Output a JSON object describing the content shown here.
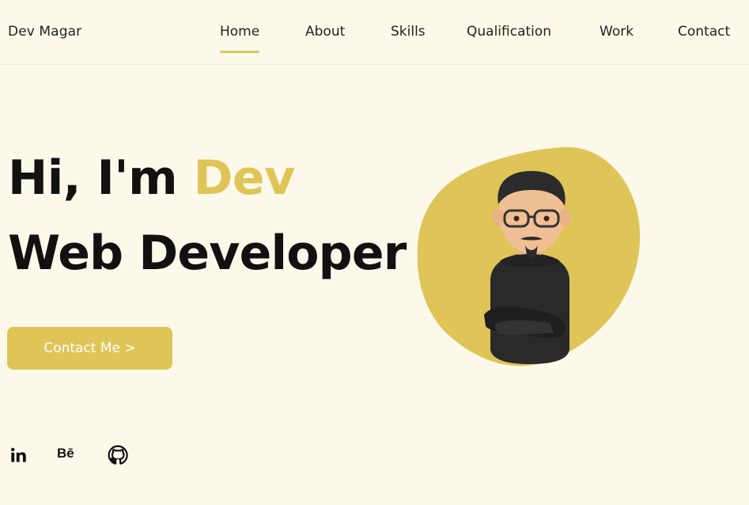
{
  "brand": {
    "name": "Dev Magar"
  },
  "nav": {
    "items": [
      {
        "label": "Home",
        "active": true
      },
      {
        "label": "About",
        "active": false
      },
      {
        "label": "Skills",
        "active": false
      },
      {
        "label": "Qualification",
        "active": false
      },
      {
        "label": "Work",
        "active": false
      },
      {
        "label": "Contact",
        "active": false
      }
    ]
  },
  "hero": {
    "greeting": "Hi, I'm ",
    "name": "Dev",
    "title": "Web Developer",
    "cta_label": "Contact Me >"
  },
  "socials": {
    "behance_label": "Bē",
    "items": [
      {
        "icon": "linkedin-icon"
      },
      {
        "icon": "behance-icon"
      },
      {
        "icon": "github-icon"
      }
    ]
  },
  "colors": {
    "background": "#fdf9ea",
    "accent": "#dfc557",
    "text": "#111111"
  }
}
